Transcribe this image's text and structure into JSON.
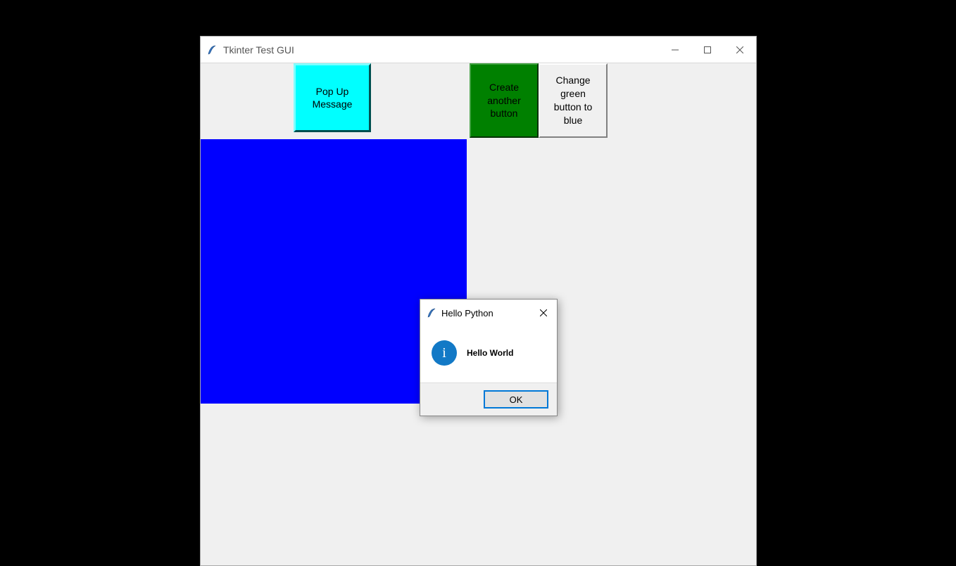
{
  "window": {
    "title": "Tkinter Test GUI"
  },
  "buttons": {
    "popup": "Pop Up\nMessage",
    "create": "Create\nanother\nbutton",
    "change": "Change\ngreen\nbutton to\nblue"
  },
  "dialog": {
    "title": "Hello Python",
    "message": "Hello World",
    "ok": "OK",
    "info_glyph": "i"
  }
}
